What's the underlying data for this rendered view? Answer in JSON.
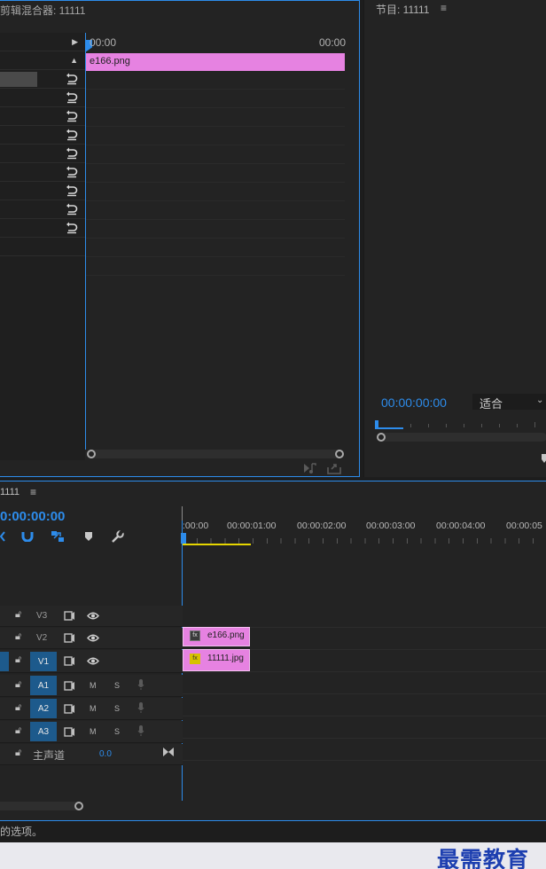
{
  "fx_panel": {
    "title": "剪辑混合器: 11111",
    "time_start": "00:00",
    "time_end": "00:00",
    "clip_label": "e166.png"
  },
  "program": {
    "title": "节目: 11111",
    "timecode": "00:00:00:00",
    "fit_label": "适合"
  },
  "timeline": {
    "title": "1111",
    "timecode": "0:00:00:00",
    "ruler": [
      ":00:00",
      "00:00:01:00",
      "00:00:02:00",
      "00:00:03:00",
      "00:00:04:00",
      "00:00:05"
    ],
    "tracks": {
      "v3": "V3",
      "v2": "V2",
      "v1": "V1",
      "a1": "A1",
      "a2": "A2",
      "a3": "A3",
      "mute": "M",
      "solo": "S",
      "master_label": "主声道",
      "master_value": "0.0"
    },
    "clips": {
      "v2": "e166.png",
      "v1": "11111.jpg",
      "fx": "fx"
    }
  },
  "status": {
    "text": "的选项。"
  },
  "watermark": "最需教育",
  "colors": {
    "accent": "#2d8ceb",
    "clip": "#e682e1",
    "track_on": "#1d5a8c"
  }
}
